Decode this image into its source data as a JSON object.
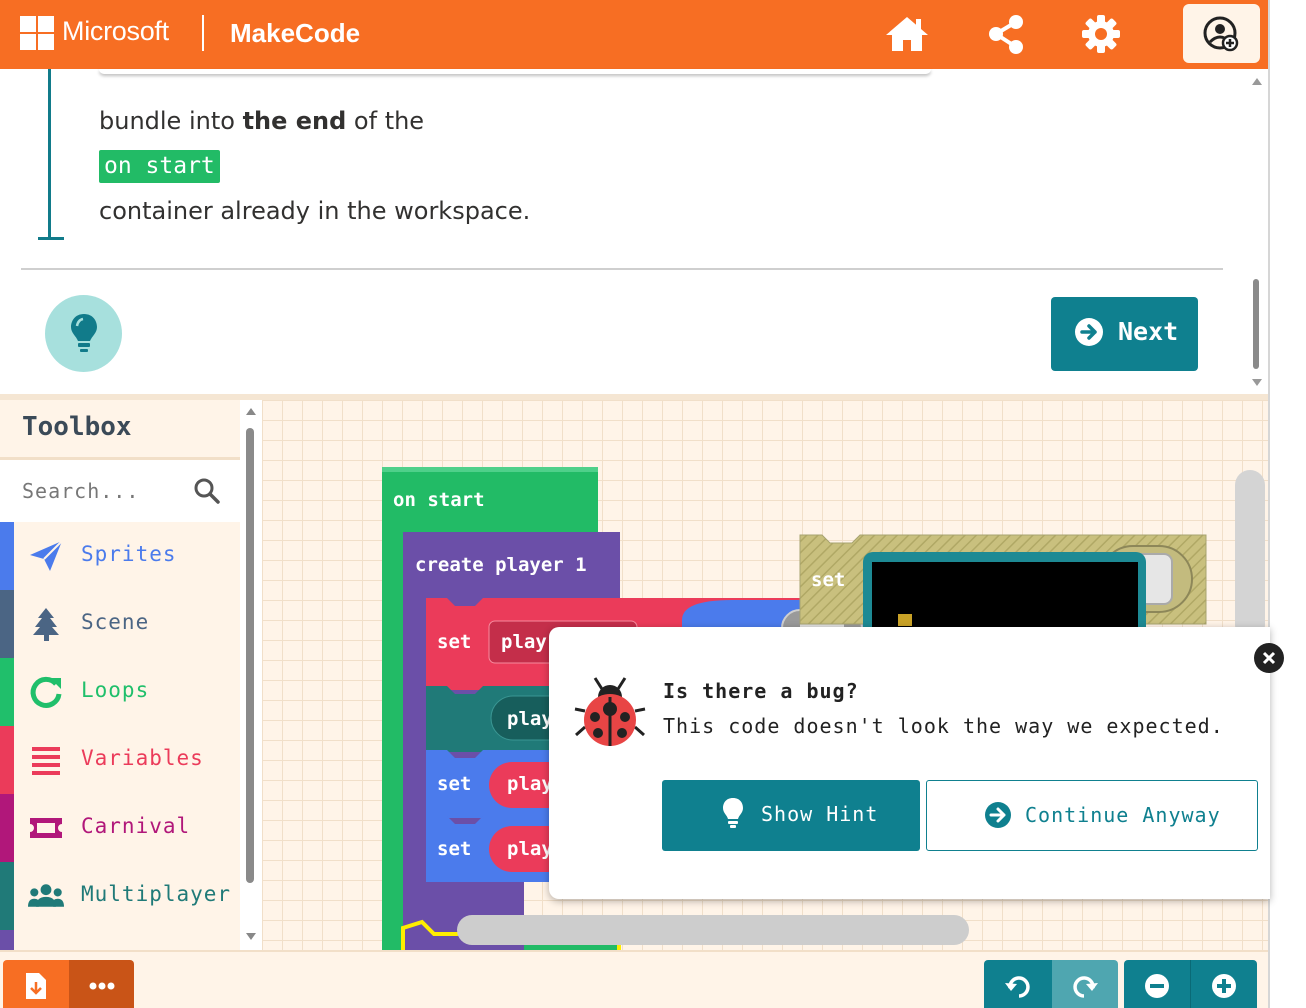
{
  "header": {
    "brand": "Microsoft",
    "product": "MakeCode",
    "icons": [
      "home-icon",
      "share-icon",
      "gear-icon",
      "profile-icon"
    ]
  },
  "tutorial": {
    "line1_pre": "bundle into ",
    "line1_bold": "the end",
    "line1_post": " of the",
    "chip": "on start",
    "line3": "container already in the workspace.",
    "next_label": "Next"
  },
  "toolbox": {
    "title": "Toolbox",
    "search_placeholder": "Search...",
    "categories": [
      {
        "label": "Sprites",
        "color": "#4b7bec",
        "icon": "paper-plane-icon"
      },
      {
        "label": "Scene",
        "color": "#4b6584",
        "icon": "tree-icon"
      },
      {
        "label": "Loops",
        "color": "#20bf6b",
        "icon": "loop-icon"
      },
      {
        "label": "Variables",
        "color": "#eb3b5a",
        "icon": "list-icon"
      },
      {
        "label": "Carnival",
        "color": "#b1177a",
        "icon": "ticket-icon"
      },
      {
        "label": "Multiplayer",
        "color": "#207a78",
        "icon": "users-icon"
      }
    ]
  },
  "blocks": {
    "on_start": "on start",
    "create_player": "create player 1",
    "set1": "set",
    "play1": "play",
    "play2": "play",
    "set2": "set",
    "play3": "play",
    "set3": "set",
    "play4": "play",
    "set_right": "set"
  },
  "dialog": {
    "title": "Is there a bug?",
    "message": "This code doesn't look the way we expected.",
    "show_hint": "Show Hint",
    "continue": "Continue Anyway"
  },
  "colors": {
    "header": "#f76e23",
    "teal": "#0f808f",
    "green": "#22bb66",
    "workspace": "#fff4e8"
  }
}
